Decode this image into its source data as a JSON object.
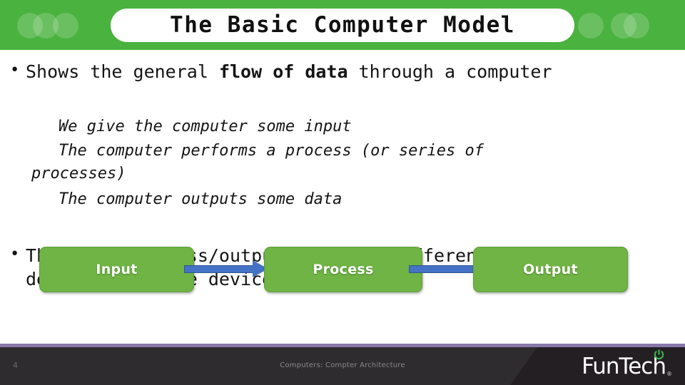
{
  "slide": {
    "title": "The Basic Computer Model",
    "header_color": "#4AB23F",
    "box_color": "#6FB444",
    "arrow_color": "#4472C4",
    "footer_color": "#2E2C2E",
    "footer_rule_color": "#8878A8"
  },
  "body": {
    "bullet_one": {
      "prefix": "Shows the general ",
      "bold": "flow of data",
      "suffix": " through a computer"
    },
    "sub_bullets": [
      "We give the computer some input",
      "The computer performs a process (or series of",
      "processes)",
      "The computer outputs some data"
    ],
    "bullet_two": "The input/process/output model is different depending on the device"
  },
  "diagram": {
    "boxes": [
      {
        "label": "Input"
      },
      {
        "label": "Process"
      },
      {
        "label": "Output"
      }
    ],
    "arrows": [
      {
        "name": "input-to-process"
      },
      {
        "name": "process-to-output"
      }
    ]
  },
  "footer": {
    "page_number": "4",
    "center_text": "Computers: Compter Architecture",
    "logo_text": "FunTech",
    "logo_registered": "®"
  }
}
